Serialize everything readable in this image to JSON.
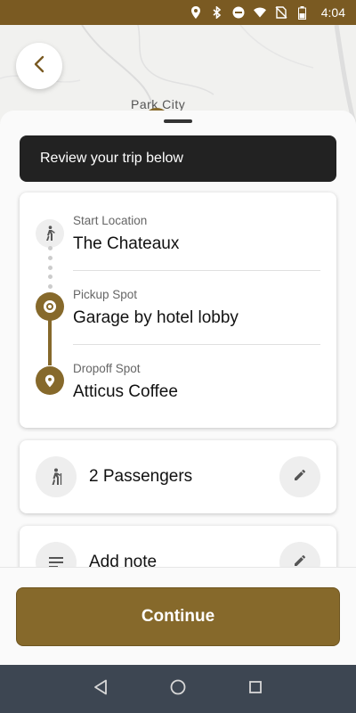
{
  "status_bar": {
    "time": "4:04",
    "icons": [
      "location-icon",
      "bluetooth-icon",
      "do-not-disturb-icon",
      "wifi-icon",
      "no-sim-icon",
      "battery-icon"
    ]
  },
  "map": {
    "place_label": "Park City"
  },
  "sheet": {
    "banner_text": "Review your trip below",
    "stops": [
      {
        "label": "Start Location",
        "value": "The Chateaux",
        "icon": "walking-person-icon"
      },
      {
        "label": "Pickup Spot",
        "value": "Garage by hotel lobby",
        "icon": "pickup-ring-icon"
      },
      {
        "label": "Dropoff Spot",
        "value": "Atticus Coffee",
        "icon": "map-pin-icon"
      }
    ],
    "passengers": {
      "text": "2 Passengers",
      "icon": "person-hiking-icon",
      "edit_icon": "pencil-icon"
    },
    "note": {
      "text": "Add note",
      "icon": "notes-lines-icon",
      "edit_icon": "pencil-icon"
    }
  },
  "footer": {
    "continue_label": "Continue"
  },
  "colors": {
    "accent": "#86692b",
    "banner_bg": "#222222",
    "status_bar": "#7a5a22",
    "nav_bar": "#3d4652"
  }
}
